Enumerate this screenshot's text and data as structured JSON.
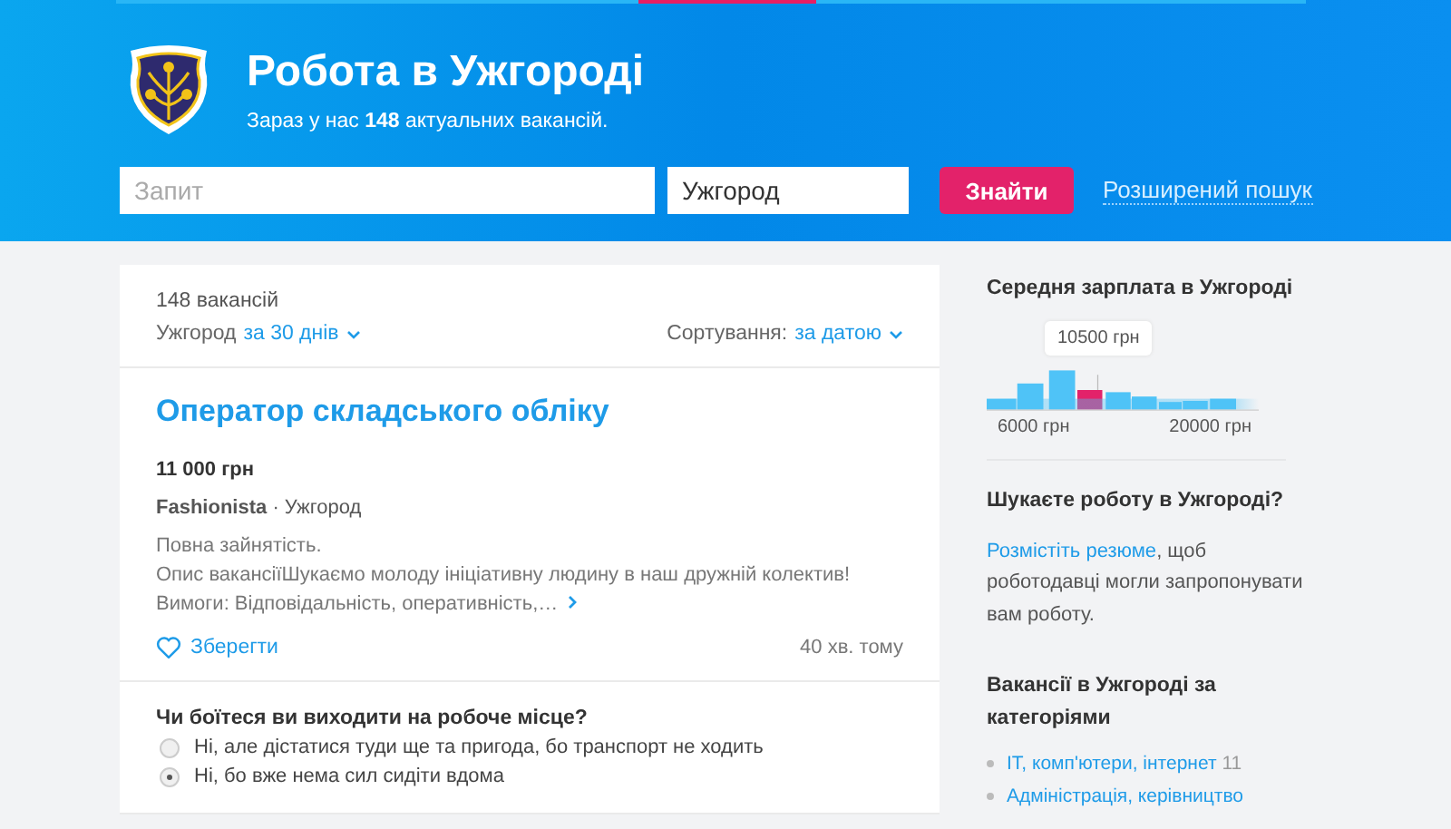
{
  "header": {
    "title": "Робота в Ужгороді",
    "subtitle": "Зараз у нас **148** актуальних вакансій."
  },
  "search": {
    "query_placeholder": "Запит",
    "city_value": "Ужгород",
    "button": "Знайти",
    "advanced_link": "Розширений пошук"
  },
  "results": {
    "count": "148 вакансій",
    "city": "Ужгород",
    "period": "за 30 днів",
    "sort_label": "Сортування:",
    "sort_value": "за датою"
  },
  "vacancy": {
    "title": "Оператор складського обліку",
    "salary": "11 000 грн",
    "company": "Fashionista",
    "city": "· Ужгород",
    "description": [
      "Повна зайнятість.",
      "Опис вакансіїШукаємо молоду ініціативну людину в наш дружній колектив!",
      "Вимоги: Відповідальність, оперативність,…"
    ],
    "save": "Зберегти",
    "time": "40 хв. тому"
  },
  "poll": {
    "question": "Чи боїтеся ви виходити на робоче місце?",
    "options": [
      {
        "label": "Ні, але дістатися туди ще та пригода, бо транспорт не ходить",
        "selected": false
      },
      {
        "label": "Ні, бо вже нема сил сидіти вдома",
        "selected": true
      }
    ]
  },
  "salary_widget": {
    "title": "Середня зарплата в Ужгороді",
    "tooltip": "10500 грн",
    "tick_labels": [
      "6000 грн",
      "20000 грн"
    ]
  },
  "resume_widget": {
    "title": "Шукаєте роботу в Ужгороді?",
    "link": "Розмістіть резюме",
    "text": ", щоб роботодавці могли запропонувати вам роботу."
  },
  "categories": {
    "title": "Вакансії в Ужгороді за категоріями",
    "items": [
      {
        "label": "IT, комп'ютери, інтернет",
        "count": "11"
      },
      {
        "label": "Адміністрація, керівництво"
      }
    ]
  }
}
